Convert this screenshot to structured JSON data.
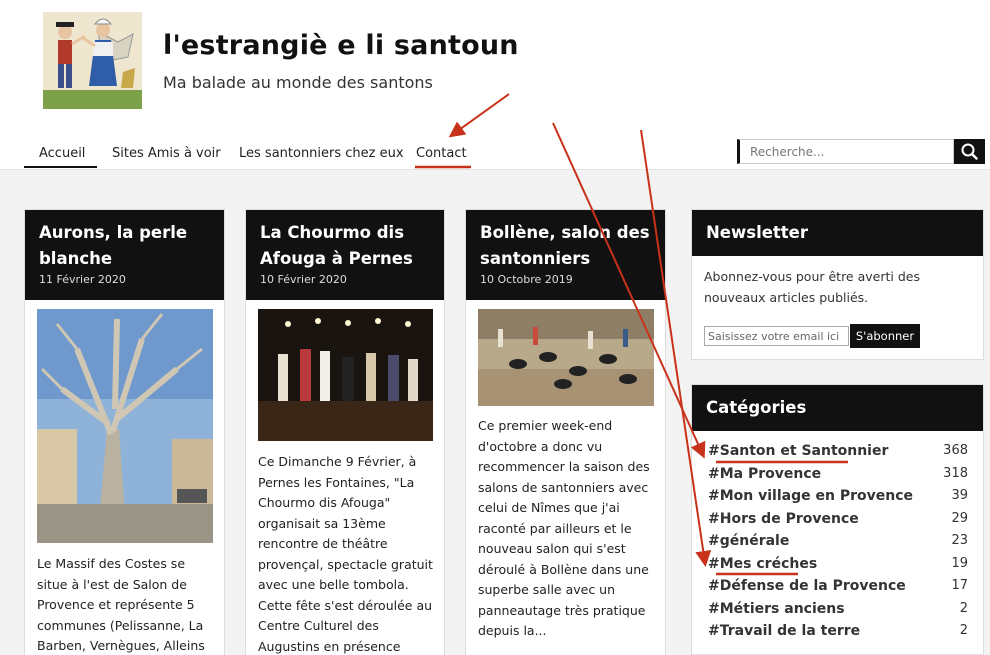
{
  "site": {
    "title": "l'estrangiè e li santoun",
    "description": "Ma balade au monde des santons"
  },
  "nav": {
    "items": [
      {
        "label": "Accueil",
        "active": true
      },
      {
        "label": "Sites Amis à voir",
        "active": false
      },
      {
        "label": "Les santonniers chez eux",
        "active": false
      },
      {
        "label": "Contact",
        "active": false
      }
    ]
  },
  "search": {
    "placeholder": "Recherche..."
  },
  "posts": [
    {
      "title": "Aurons, la perle blanche",
      "date": "11 Février 2020",
      "excerpt": "Le Massif des Costes se situe à l'est de Salon de Provence et représente 5 communes (Pelissanne, La Barben, Vernègues, Alleins et"
    },
    {
      "title": "La Chourmo dis Afouga à Pernes",
      "date": "10 Février 2020",
      "excerpt": "Ce Dimanche 9 Février, à Pernes les Fontaines, \"La Chourmo dis Afouga\" organisait sa 13ème rencontre de théâtre provençal, spectacle gratuit avec une belle tombola. Cette fête s'est déroulée au Centre Culturel des Augustins en présence d'une"
    },
    {
      "title": "Bollène, salon des santonniers",
      "date": "10 Octobre 2019",
      "excerpt": "Ce premier week-end d'octobre a donc vu recommencer la saison des salons de santonniers avec celui de Nîmes que j'ai raconté par ailleurs et le nouveau salon qui s'est déroulé à Bollène dans une superbe salle avec un panneautage très pratique depuis la..."
    }
  ],
  "newsletter": {
    "heading": "Newsletter",
    "text": "Abonnez-vous pour être averti des nouveaux articles publiés.",
    "placeholder": "Saisissez votre email ici",
    "button": "S'abonner"
  },
  "categories": {
    "heading": "Catégories",
    "items": [
      {
        "name": "#Santon et Santonnier",
        "count": "368"
      },
      {
        "name": "#Ma Provence",
        "count": "318"
      },
      {
        "name": "#Mon village en Provence",
        "count": "39"
      },
      {
        "name": "#Hors de Provence",
        "count": "29"
      },
      {
        "name": "#générale",
        "count": "23"
      },
      {
        "name": "#Mes créches",
        "count": "19"
      },
      {
        "name": "#Défense de la Provence",
        "count": "17"
      },
      {
        "name": "#Métiers anciens",
        "count": "2"
      },
      {
        "name": "#Travail de la terre",
        "count": "2"
      }
    ]
  },
  "colors": {
    "accent": "#111111",
    "annotation": "#c8321a"
  },
  "icons": {
    "search": "search-icon"
  }
}
